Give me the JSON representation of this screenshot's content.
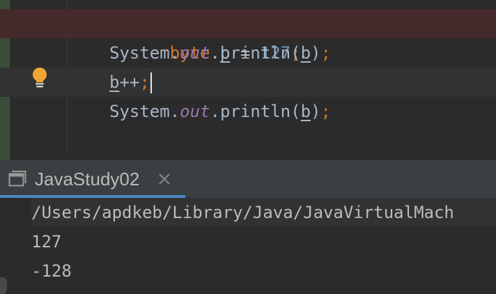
{
  "editor": {
    "line1": {
      "keyword": "byte",
      "var": "b",
      "op": " = ",
      "number": "127",
      "semi": ";"
    },
    "line2": {
      "cls": "System.",
      "field": "out",
      "method": ".println(",
      "var": "b",
      "close": ")",
      "semi": ";"
    },
    "line3": {
      "var": "b",
      "op": "++",
      "semi": ";"
    },
    "line4": {
      "cls": "System.",
      "field": "out",
      "method": ".println(",
      "var": "b",
      "close": ")",
      "semi": ";"
    },
    "gutter_icon": "lightbulb-icon"
  },
  "run_panel": {
    "tab_label": "JavaStudy02",
    "tab_icon": "console-icon",
    "close_icon": "close-icon",
    "output": [
      "/Users/apdkeb/Library/Java/JavaVirtualMach",
      "127",
      "-128"
    ]
  },
  "colors": {
    "keyword": "#cc7832",
    "number": "#6897bb",
    "field": "#9876aa",
    "text": "#a9b7c6",
    "error_line": "#452a2b",
    "bulb": "#f0a732"
  }
}
